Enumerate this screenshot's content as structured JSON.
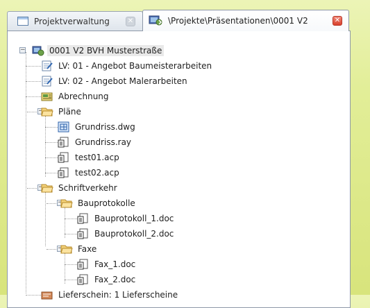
{
  "tabs": [
    {
      "label": "Projektverwaltung"
    },
    {
      "label": "\\Projekte\\Präsentationen\\0001 V2"
    }
  ],
  "tree": {
    "root": {
      "label": "0001 V2 BVH Musterstraße",
      "icon": "project-icon"
    },
    "items": [
      {
        "label": "LV: 01 - Angebot Baumeisterarbeiten",
        "icon": "document-edit-icon"
      },
      {
        "label": "LV: 02 - Angebot Malerarbeiten",
        "icon": "document-edit-icon"
      },
      {
        "label": "Abrechnung",
        "icon": "invoice-icon"
      },
      {
        "label": "Pläne",
        "icon": "folder-open-icon"
      },
      {
        "label": "Grundriss.dwg",
        "icon": "plan-file-icon"
      },
      {
        "label": "Grundriss.ray",
        "icon": "document-file-icon"
      },
      {
        "label": "test01.acp",
        "icon": "document-file-icon"
      },
      {
        "label": "test02.acp",
        "icon": "document-file-icon"
      },
      {
        "label": "Schriftverkehr",
        "icon": "folder-open-icon"
      },
      {
        "label": "Bauprotokolle",
        "icon": "folder-open-icon"
      },
      {
        "label": "Bauprotokoll_1.doc",
        "icon": "document-file-icon"
      },
      {
        "label": "Bauprotokoll_2.doc",
        "icon": "document-file-icon"
      },
      {
        "label": "Faxe",
        "icon": "folder-open-icon"
      },
      {
        "label": "Fax_1.doc",
        "icon": "document-file-icon"
      },
      {
        "label": "Fax_2.doc",
        "icon": "document-file-icon"
      },
      {
        "label": "Lieferschein: 1 Lieferscheine",
        "icon": "delivery-note-icon"
      }
    ]
  },
  "colors": {
    "background": "#e2ee98",
    "panel": "#ffffff",
    "selection": "#e9e9e9"
  }
}
